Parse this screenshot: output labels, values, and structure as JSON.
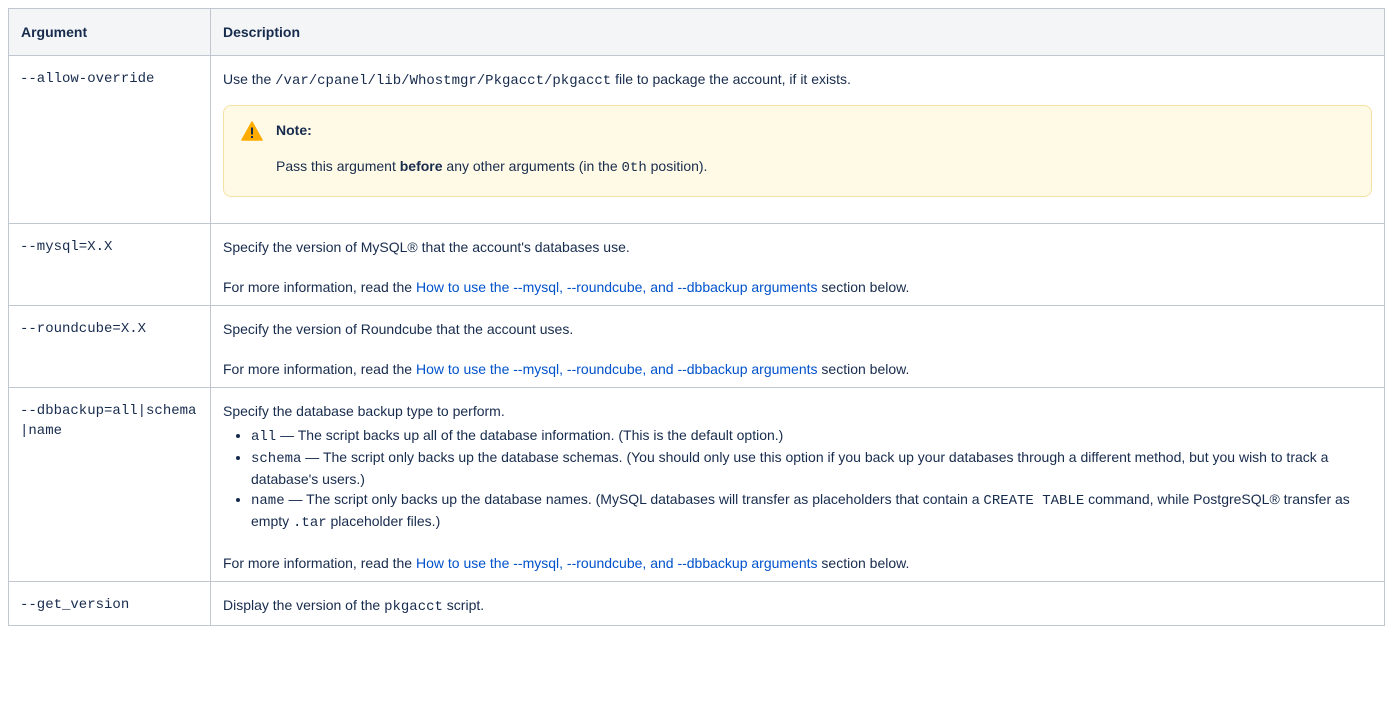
{
  "table": {
    "headers": {
      "argument": "Argument",
      "description": "Description"
    },
    "rows": {
      "allow_override": {
        "arg": "--allow-override",
        "text_before": "Use the ",
        "path": "/var/cpanel/lib/Whostmgr/Pkgacct/pkgacct",
        "text_after": " file to package the account, if it exists.",
        "note": {
          "title": "Note:",
          "text_before": "Pass this argument ",
          "bold": "before",
          "text_middle": " any other arguments (in the ",
          "code": "0th",
          "text_after": " position)."
        }
      },
      "mysql": {
        "arg": "--mysql=X.X",
        "line1": "Specify the version of MySQL® that the account's databases use.",
        "more_before": "For more information, read the ",
        "more_link": "How to use the --mysql, --roundcube, and --dbbackup arguments",
        "more_after": " section below."
      },
      "roundcube": {
        "arg": "--roundcube=X.X",
        "line1": "Specify the version of Roundcube that the account uses.",
        "more_before": "For more information, read the ",
        "more_link": "How to use the --mysql, --roundcube, and --dbbackup arguments",
        "more_after": " section below."
      },
      "dbbackup": {
        "arg": "--dbbackup=all|schema|name",
        "line1": "Specify the database backup type to perform.",
        "items": [
          {
            "code": "all",
            "text": " — The script backs up all of the database information. (This is the default option.)"
          },
          {
            "code": "schema",
            "text": " — The script only backs up the database schemas. (You should only use this option if you back up your databases through a different method, but you wish to track a database's users.)"
          },
          {
            "code": "name",
            "text": " — The script only backs up the database names. (MySQL databases will transfer as placeholders that contain a ",
            "code2": "CREATE TABLE",
            "text2": " command, while PostgreSQL® transfer as empty ",
            "code3": ".tar",
            "text3": " placeholder files.)"
          }
        ],
        "more_before": "For more information, read the ",
        "more_link": "How to use the --mysql, --roundcube, and --dbbackup arguments",
        "more_after": " section below."
      },
      "get_version": {
        "arg": "--get_version",
        "text_before": "Display the version of the ",
        "code": "pkgacct",
        "text_after": " script."
      }
    }
  },
  "colors": {
    "link": "#0052cc",
    "note_bg": "#fffae6",
    "header_bg": "#f4f5f7",
    "warning": "#ffab00"
  },
  "icons": {
    "note_icon": "warning-icon"
  }
}
